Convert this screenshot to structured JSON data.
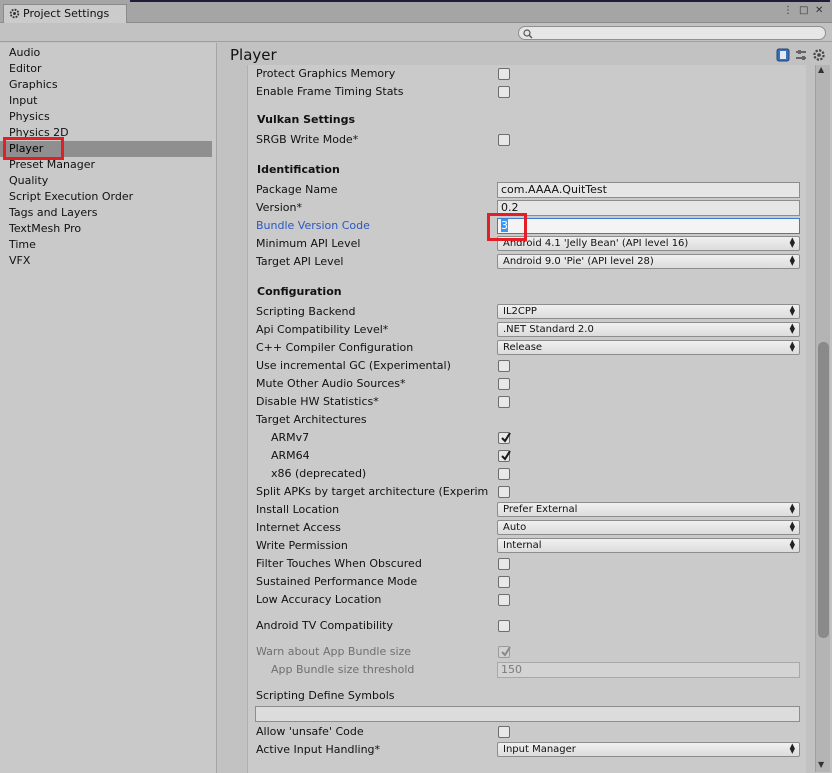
{
  "window": {
    "tab_title": "Project Settings",
    "controls": [
      "⋮",
      "□",
      "✕"
    ]
  },
  "search": {
    "placeholder": "",
    "value": ""
  },
  "sidebar": {
    "items": [
      {
        "label": "Audio"
      },
      {
        "label": "Editor"
      },
      {
        "label": "Graphics"
      },
      {
        "label": "Input"
      },
      {
        "label": "Physics"
      },
      {
        "label": "Physics 2D"
      },
      {
        "label": "Player",
        "selected": true
      },
      {
        "label": "Preset Manager"
      },
      {
        "label": "Quality"
      },
      {
        "label": "Script Execution Order"
      },
      {
        "label": "Tags and Layers"
      },
      {
        "label": "TextMesh Pro"
      },
      {
        "label": "Time"
      },
      {
        "label": "VFX"
      }
    ]
  },
  "main": {
    "title": "Player",
    "header_icons": [
      "help-book-icon",
      "settings-sliders-icon",
      "gear-icon"
    ],
    "rows": {
      "protect_graphics_memory": {
        "label": "Protect Graphics Memory",
        "checked": false
      },
      "enable_frame_timing": {
        "label": "Enable Frame Timing Stats",
        "checked": false
      },
      "vulkan_section": "Vulkan Settings",
      "srgb_write_mode": {
        "label": "SRGB Write Mode*",
        "checked": false
      },
      "identification_section": "Identification",
      "package_name": {
        "label": "Package Name",
        "value": "com.AAAA.QuitTest"
      },
      "version": {
        "label": "Version*",
        "value": "0.2"
      },
      "bundle_version_code": {
        "label": "Bundle Version Code",
        "value": "3"
      },
      "min_api_level": {
        "label": "Minimum API Level",
        "value": "Android 4.1 'Jelly Bean' (API level 16)"
      },
      "target_api_level": {
        "label": "Target API Level",
        "value": "Android 9.0 'Pie' (API level 28)"
      },
      "configuration_section": "Configuration",
      "scripting_backend": {
        "label": "Scripting Backend",
        "value": "IL2CPP"
      },
      "api_compat": {
        "label": "Api Compatibility Level*",
        "value": ".NET Standard 2.0"
      },
      "cpp_compiler": {
        "label": "C++ Compiler Configuration",
        "value": "Release"
      },
      "incremental_gc": {
        "label": "Use incremental GC (Experimental)",
        "checked": false
      },
      "mute_audio": {
        "label": "Mute Other Audio Sources*",
        "checked": false
      },
      "disable_hw_stats": {
        "label": "Disable HW Statistics*",
        "checked": false
      },
      "target_arch": {
        "label": "Target Architectures"
      },
      "armv7": {
        "label": "ARMv7",
        "checked": true
      },
      "arm64": {
        "label": "ARM64",
        "checked": true
      },
      "x86": {
        "label": "x86 (deprecated)",
        "checked": false
      },
      "split_apks": {
        "label": "Split APKs by target architecture (Experim",
        "checked": false
      },
      "install_location": {
        "label": "Install Location",
        "value": "Prefer External"
      },
      "internet_access": {
        "label": "Internet Access",
        "value": "Auto"
      },
      "write_permission": {
        "label": "Write Permission",
        "value": "Internal"
      },
      "filter_touches": {
        "label": "Filter Touches When Obscured",
        "checked": false
      },
      "sustained_perf": {
        "label": "Sustained Performance Mode",
        "checked": false
      },
      "low_accuracy_location": {
        "label": "Low Accuracy Location",
        "checked": false
      },
      "android_tv": {
        "label": "Android TV Compatibility",
        "checked": false
      },
      "warn_app_bundle": {
        "label": "Warn about App Bundle size",
        "checked": true
      },
      "app_bundle_threshold": {
        "label": "App Bundle size threshold",
        "value": "150"
      },
      "scripting_define": {
        "label": "Scripting Define Symbols",
        "value": ""
      },
      "allow_unsafe": {
        "label": "Allow 'unsafe' Code",
        "checked": false
      },
      "active_input": {
        "label": "Active Input Handling*",
        "value": "Input Manager"
      }
    }
  },
  "colors": {
    "highlight_red": "#e41e26",
    "link_blue": "#2a58c0",
    "selection_blue": "#3399ff"
  }
}
